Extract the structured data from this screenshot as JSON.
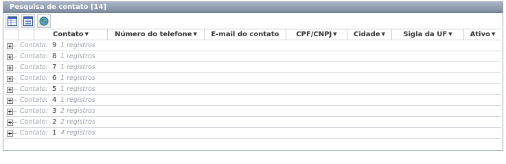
{
  "panel": {
    "title": "Pesquisa de contato [14]"
  },
  "toolbar": {
    "buttons": [
      {
        "icon": "table-view-icon"
      },
      {
        "icon": "form-view-icon"
      },
      {
        "icon": "globe-icon"
      }
    ]
  },
  "grid": {
    "columns": [
      {
        "label": "Contato",
        "sortable": true
      },
      {
        "label": "Número do telefone",
        "sortable": true
      },
      {
        "label": "E-mail do contato",
        "sortable": false
      },
      {
        "label": "CPF/CNPJ",
        "sortable": true
      },
      {
        "label": "Cidade",
        "sortable": true
      },
      {
        "label": "Sigla da UF",
        "sortable": true
      },
      {
        "label": "Ativo",
        "sortable": true
      }
    ],
    "group_label": "Contato:",
    "groups": [
      {
        "value": "9",
        "count": "1 registros"
      },
      {
        "value": "8",
        "count": "1 registros"
      },
      {
        "value": "7",
        "count": "1 registros"
      },
      {
        "value": "6",
        "count": "1 registros"
      },
      {
        "value": "5",
        "count": "1 registros"
      },
      {
        "value": "4",
        "count": "1 registros"
      },
      {
        "value": "3",
        "count": "2 registros"
      },
      {
        "value": "2",
        "count": "2 registros"
      },
      {
        "value": "1",
        "count": "4 registros"
      }
    ]
  }
}
